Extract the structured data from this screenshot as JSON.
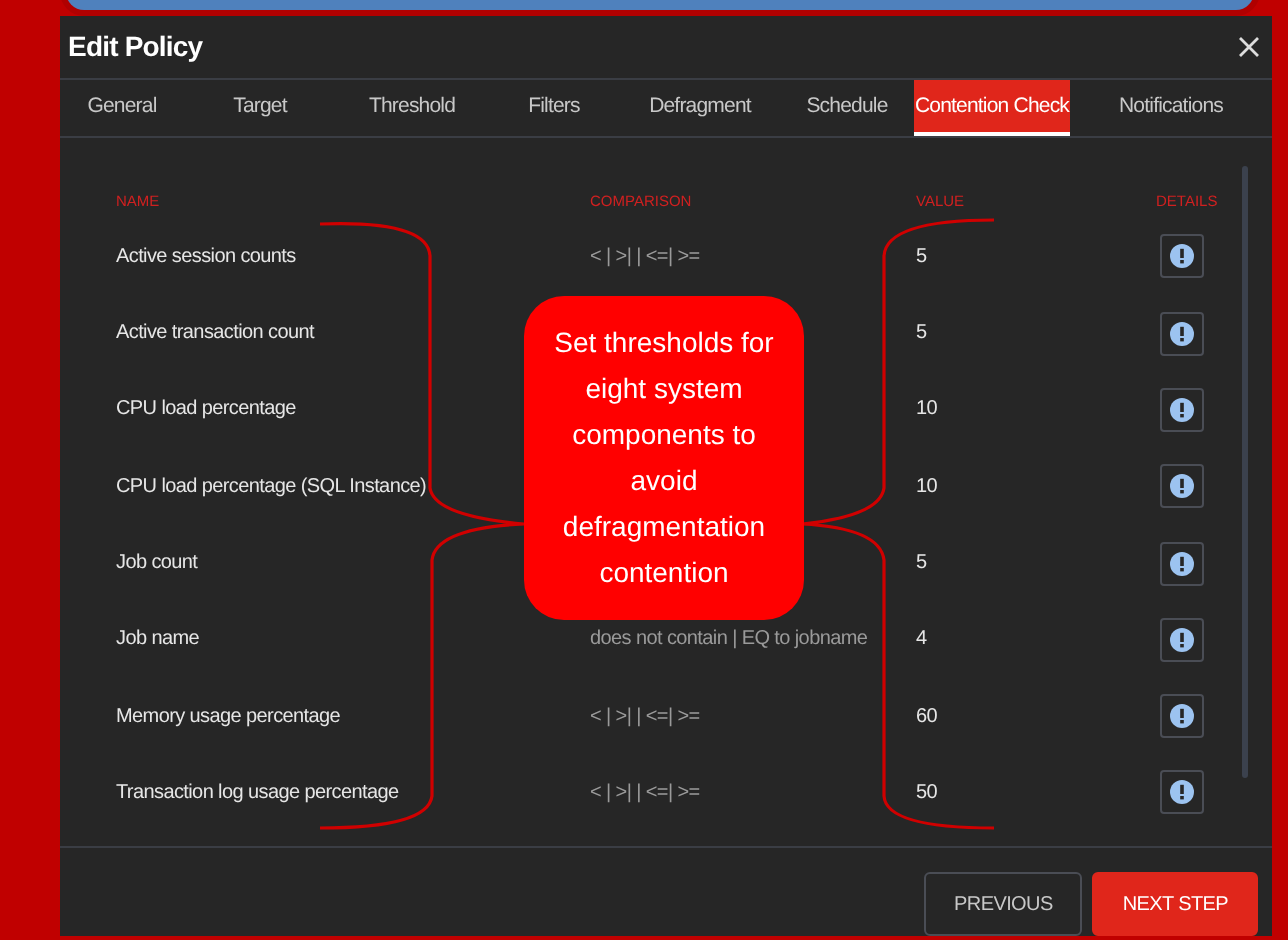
{
  "dialog": {
    "title": "Edit Policy"
  },
  "tabs": [
    {
      "label": "General",
      "selected": false
    },
    {
      "label": "Target",
      "selected": false
    },
    {
      "label": "Threshold",
      "selected": false
    },
    {
      "label": "Filters",
      "selected": false
    },
    {
      "label": "Defragment",
      "selected": false
    },
    {
      "label": "Schedule",
      "selected": false
    },
    {
      "label": "Contention Check",
      "selected": true
    },
    {
      "label": "Notifications",
      "selected": false
    }
  ],
  "table": {
    "columns": [
      "NAME",
      "COMPARISON",
      "VALUE",
      "DETAILS"
    ],
    "rows": [
      {
        "name": "Active session counts",
        "comparison": "< | >| | <=| >=",
        "value": "5"
      },
      {
        "name": "Active transaction count",
        "value": "5"
      },
      {
        "name": "CPU load percentage",
        "value": "10"
      },
      {
        "name": "CPU load percentage (SQL Instance)",
        "value": "10"
      },
      {
        "name": "Job count",
        "value": "5"
      },
      {
        "name": "Job name",
        "comparison": "does not contain | EQ to jobname",
        "value": "4"
      },
      {
        "name": "Memory usage percentage",
        "comparison": "< | >| | <=| >=",
        "value": "60"
      },
      {
        "name": "Transaction log usage percentage",
        "comparison": "< | >| | <=| >=",
        "value": "50"
      }
    ]
  },
  "callout": {
    "text": "Set thresholds for eight system components to avoid defragmentation contention"
  },
  "buttons": [
    {
      "label": "PREVIOUS",
      "kind": "secondary"
    },
    {
      "label": "NEXT STEP",
      "kind": "primary"
    }
  ]
}
